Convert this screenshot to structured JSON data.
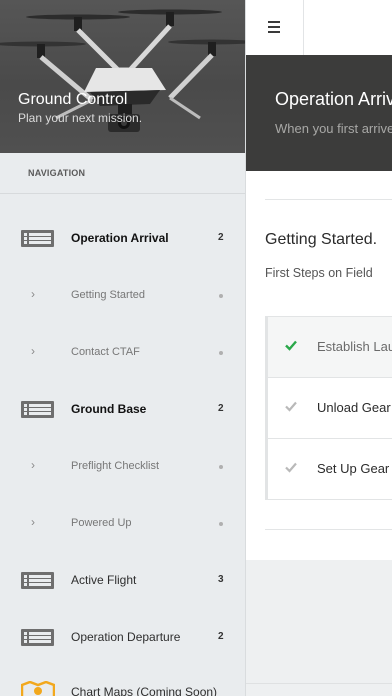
{
  "sidebar": {
    "brand": {
      "title": "Ground Control",
      "subtitle": "Plan your next mission."
    },
    "nav_header": "NAVIGATION",
    "items": [
      {
        "label": "Operation Arrival",
        "count": "2",
        "icon": "list-icon",
        "active": true
      },
      {
        "label": "Getting Started",
        "sub": true
      },
      {
        "label": "Contact CTAF",
        "sub": true
      },
      {
        "label": "Ground Base",
        "count": "2",
        "icon": "list-icon",
        "active": true
      },
      {
        "label": "Preflight Checklist",
        "sub": true
      },
      {
        "label": "Powered Up",
        "sub": true
      },
      {
        "label": "Active Flight",
        "count": "3",
        "icon": "list-icon"
      },
      {
        "label": "Operation Departure",
        "count": "2",
        "icon": "list-icon"
      },
      {
        "label": "Chart Maps (Coming Soon)",
        "icon": "map-icon"
      }
    ]
  },
  "main": {
    "menu_icon": "hamburger-icon",
    "hero": {
      "title": "Operation Arrival",
      "subtitle": "When you first arrive"
    },
    "section": {
      "title": "Getting Started.",
      "subtitle": "First Steps on Field"
    },
    "checklist": [
      {
        "label": "Establish Launch",
        "done": true
      },
      {
        "label": "Unload Gear",
        "done": false
      },
      {
        "label": "Set Up Gear",
        "done": false
      }
    ]
  },
  "colors": {
    "check_done": "#2aa84a",
    "check_pending": "#b9b9b9",
    "map_icon": "#f2a81d",
    "hero_bg": "#3c3c3b"
  }
}
